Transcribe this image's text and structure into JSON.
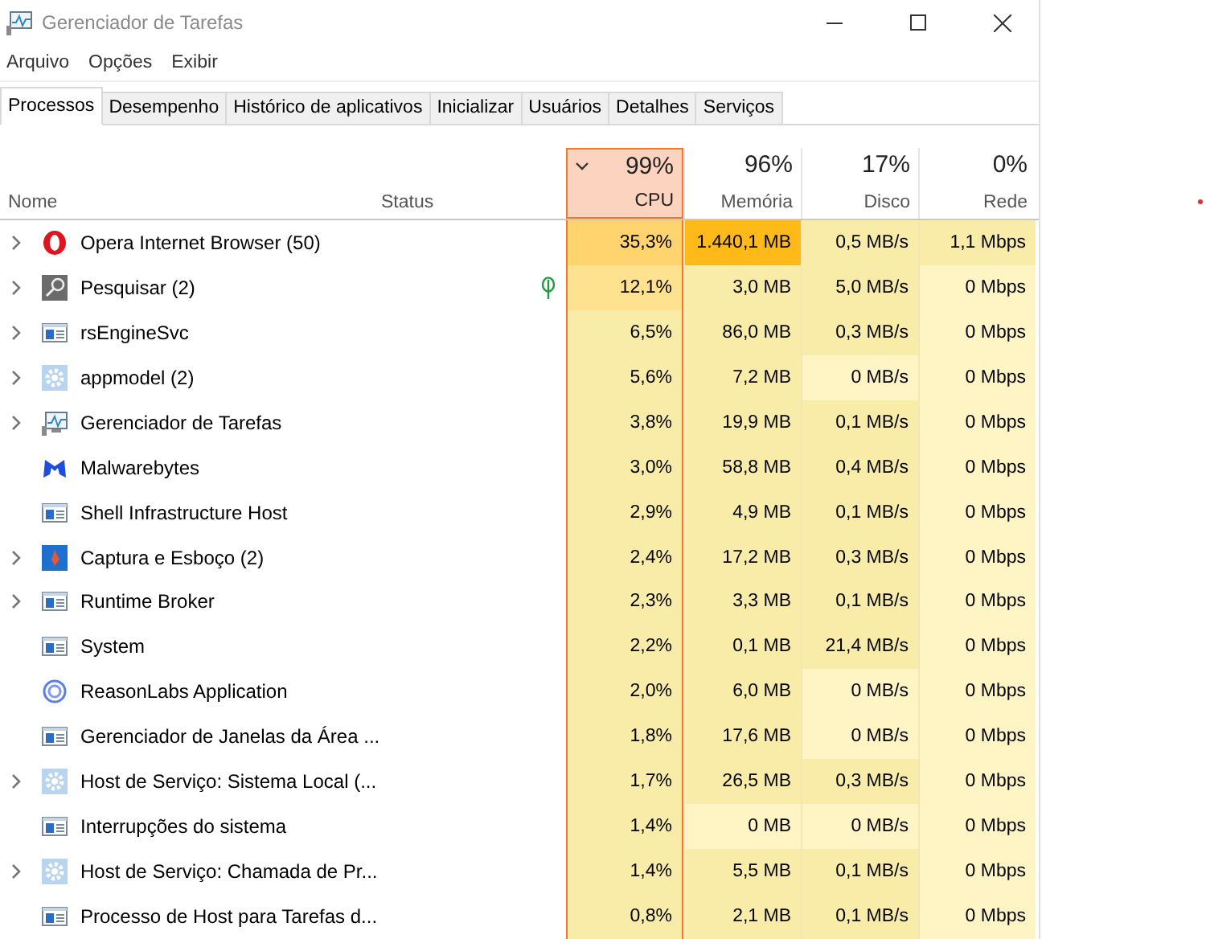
{
  "window": {
    "title": "Gerenciador de Tarefas"
  },
  "menu": [
    "Arquivo",
    "Opções",
    "Exibir"
  ],
  "tabs": [
    {
      "label": "Processos",
      "selected": true
    },
    {
      "label": "Desempenho",
      "selected": false
    },
    {
      "label": "Histórico de aplicativos",
      "selected": false
    },
    {
      "label": "Inicializar",
      "selected": false
    },
    {
      "label": "Usuários",
      "selected": false
    },
    {
      "label": "Detalhes",
      "selected": false
    },
    {
      "label": "Serviços",
      "selected": false
    }
  ],
  "columns": [
    {
      "label": "Nome",
      "sorted": false
    },
    {
      "label": "Status",
      "sorted": false
    },
    {
      "label": "CPU",
      "total": "99%",
      "sorted": true
    },
    {
      "label": "Memória",
      "total": "96%",
      "sorted": false
    },
    {
      "label": "Disco",
      "total": "17%",
      "sorted": false
    },
    {
      "label": "Rede",
      "total": "0%",
      "sorted": false
    }
  ],
  "rows": [
    {
      "name": "Opera Internet Browser (50)",
      "kind": "opera",
      "expandable": true,
      "eco": false,
      "cells": [
        {
          "value": "35,3%",
          "color": "#ffd46e"
        },
        {
          "value": "1.440,1 MB",
          "color": "#ffb918"
        },
        {
          "value": "0,5 MB/s",
          "color": "#f9eca8"
        },
        {
          "value": "1,1 Mbps",
          "color": "#f9eca8"
        }
      ]
    },
    {
      "name": "Pesquisar (2)",
      "kind": "search",
      "expandable": true,
      "eco": true,
      "cells": [
        {
          "value": "12,1%",
          "color": "#ffe290"
        },
        {
          "value": "3,0 MB",
          "color": "#f9eca8"
        },
        {
          "value": "5,0 MB/s",
          "color": "#f9eca8"
        },
        {
          "value": "0 Mbps",
          "color": "#fff4c4"
        }
      ]
    },
    {
      "name": "rsEngineSvc",
      "kind": "window",
      "expandable": true,
      "eco": false,
      "cells": [
        {
          "value": "6,5%",
          "color": "#f9eca8"
        },
        {
          "value": "86,0 MB",
          "color": "#f9eca8"
        },
        {
          "value": "0,3 MB/s",
          "color": "#f9eca8"
        },
        {
          "value": "0 Mbps",
          "color": "#fff4c4"
        }
      ]
    },
    {
      "name": "appmodel (2)",
      "kind": "gear",
      "expandable": true,
      "eco": false,
      "cells": [
        {
          "value": "5,6%",
          "color": "#f9eca8"
        },
        {
          "value": "7,2 MB",
          "color": "#f9eca8"
        },
        {
          "value": "0 MB/s",
          "color": "#fff4c4"
        },
        {
          "value": "0 Mbps",
          "color": "#fff4c4"
        }
      ]
    },
    {
      "name": "Gerenciador de Tarefas",
      "kind": "monitor",
      "expandable": true,
      "eco": false,
      "cells": [
        {
          "value": "3,8%",
          "color": "#f9eca8"
        },
        {
          "value": "19,9 MB",
          "color": "#f9eca8"
        },
        {
          "value": "0,1 MB/s",
          "color": "#f9eca8"
        },
        {
          "value": "0 Mbps",
          "color": "#fff4c4"
        }
      ]
    },
    {
      "name": "Malwarebytes",
      "kind": "m",
      "expandable": false,
      "eco": false,
      "cells": [
        {
          "value": "3,0%",
          "color": "#f9eca8"
        },
        {
          "value": "58,8 MB",
          "color": "#f9eca8"
        },
        {
          "value": "0,4 MB/s",
          "color": "#f9eca8"
        },
        {
          "value": "0 Mbps",
          "color": "#fff4c4"
        }
      ]
    },
    {
      "name": "Shell Infrastructure Host",
      "kind": "window",
      "expandable": false,
      "eco": false,
      "cells": [
        {
          "value": "2,9%",
          "color": "#f9eca8"
        },
        {
          "value": "4,9 MB",
          "color": "#f9eca8"
        },
        {
          "value": "0,1 MB/s",
          "color": "#f9eca8"
        },
        {
          "value": "0 Mbps",
          "color": "#fff4c4"
        }
      ]
    },
    {
      "name": "Captura e Esboço (2)",
      "kind": "snip",
      "expandable": true,
      "eco": false,
      "cells": [
        {
          "value": "2,4%",
          "color": "#f9eca8"
        },
        {
          "value": "17,2 MB",
          "color": "#f9eca8"
        },
        {
          "value": "0,3 MB/s",
          "color": "#f9eca8"
        },
        {
          "value": "0 Mbps",
          "color": "#fff4c4"
        }
      ]
    },
    {
      "name": "Runtime Broker",
      "kind": "window",
      "expandable": true,
      "eco": false,
      "cells": [
        {
          "value": "2,3%",
          "color": "#f9eca8"
        },
        {
          "value": "3,3 MB",
          "color": "#f9eca8"
        },
        {
          "value": "0,1 MB/s",
          "color": "#f9eca8"
        },
        {
          "value": "0 Mbps",
          "color": "#fff4c4"
        }
      ]
    },
    {
      "name": "System",
      "kind": "window",
      "expandable": false,
      "eco": false,
      "cells": [
        {
          "value": "2,2%",
          "color": "#f9eca8"
        },
        {
          "value": "0,1 MB",
          "color": "#f9eca8"
        },
        {
          "value": "21,4 MB/s",
          "color": "#f9eca8"
        },
        {
          "value": "0 Mbps",
          "color": "#fff4c4"
        }
      ]
    },
    {
      "name": "ReasonLabs Application",
      "kind": "ring",
      "expandable": false,
      "eco": false,
      "cells": [
        {
          "value": "2,0%",
          "color": "#f9eca8"
        },
        {
          "value": "6,0 MB",
          "color": "#f9eca8"
        },
        {
          "value": "0 MB/s",
          "color": "#fff4c4"
        },
        {
          "value": "0 Mbps",
          "color": "#fff4c4"
        }
      ]
    },
    {
      "name": "Gerenciador de Janelas da Área ...",
      "kind": "window",
      "expandable": false,
      "eco": false,
      "cells": [
        {
          "value": "1,8%",
          "color": "#f9eca8"
        },
        {
          "value": "17,6 MB",
          "color": "#f9eca8"
        },
        {
          "value": "0 MB/s",
          "color": "#fff4c4"
        },
        {
          "value": "0 Mbps",
          "color": "#fff4c4"
        }
      ]
    },
    {
      "name": "Host de Serviço: Sistema Local (...",
      "kind": "gear",
      "expandable": true,
      "eco": false,
      "cells": [
        {
          "value": "1,7%",
          "color": "#f9eca8"
        },
        {
          "value": "26,5 MB",
          "color": "#f9eca8"
        },
        {
          "value": "0,3 MB/s",
          "color": "#f9eca8"
        },
        {
          "value": "0 Mbps",
          "color": "#fff4c4"
        }
      ]
    },
    {
      "name": "Interrupções do sistema",
      "kind": "window",
      "expandable": false,
      "eco": false,
      "cells": [
        {
          "value": "1,4%",
          "color": "#f9eca8"
        },
        {
          "value": "0 MB",
          "color": "#fff4c4"
        },
        {
          "value": "0 MB/s",
          "color": "#fff4c4"
        },
        {
          "value": "0 Mbps",
          "color": "#fff4c4"
        }
      ]
    },
    {
      "name": "Host de Serviço: Chamada de Pr...",
      "kind": "gear",
      "expandable": true,
      "eco": false,
      "cells": [
        {
          "value": "1,4%",
          "color": "#f9eca8"
        },
        {
          "value": "5,5 MB",
          "color": "#f9eca8"
        },
        {
          "value": "0,1 MB/s",
          "color": "#f9eca8"
        },
        {
          "value": "0 Mbps",
          "color": "#fff4c4"
        }
      ]
    },
    {
      "name": "Processo de Host para Tarefas d...",
      "kind": "window",
      "expandable": false,
      "eco": false,
      "cells": [
        {
          "value": "0,8%",
          "color": "#f9eca8"
        },
        {
          "value": "2,1 MB",
          "color": "#f9eca8"
        },
        {
          "value": "0,1 MB/s",
          "color": "#f9eca8"
        },
        {
          "value": "0 Mbps",
          "color": "#fff4c4"
        }
      ]
    }
  ]
}
